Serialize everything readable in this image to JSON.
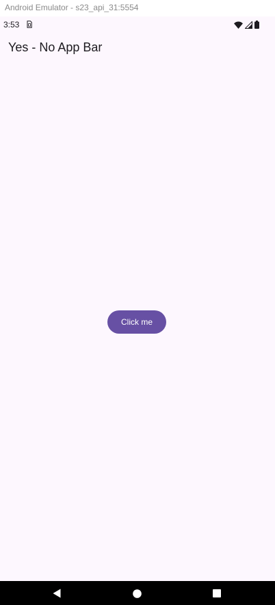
{
  "window": {
    "title": "Android Emulator - s23_api_31:5554"
  },
  "status_bar": {
    "time": "3:53",
    "icons": [
      "sim-card-icon",
      "wifi-icon",
      "signal-icon",
      "battery-icon"
    ]
  },
  "screen": {
    "title": "Yes - No App Bar",
    "button_label": "Click me",
    "background_color": "#fdf7fe",
    "accent_color": "#6750a4"
  },
  "nav_bar": {
    "buttons": [
      "back-icon",
      "home-icon",
      "recents-icon"
    ]
  }
}
